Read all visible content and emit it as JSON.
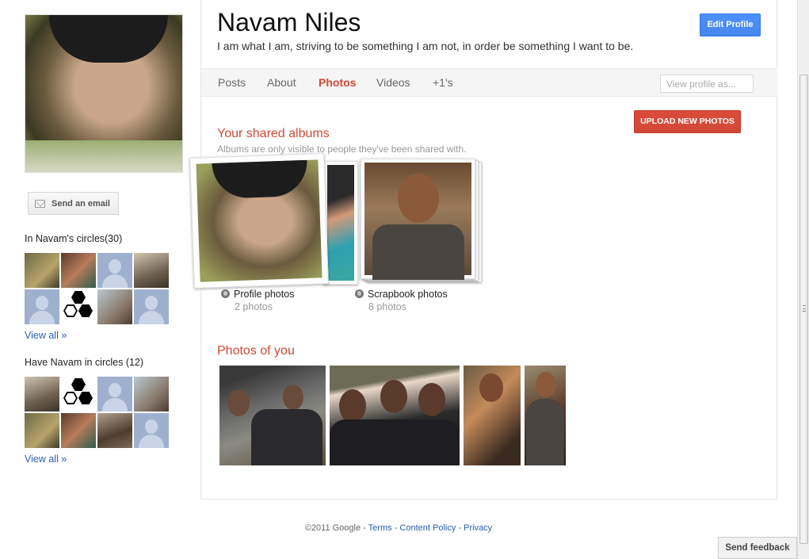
{
  "profile": {
    "name": "Navam Niles",
    "tagline": "I am what I am, striving to be something I am not, in order be something I want to be.",
    "edit_button": "Edit Profile"
  },
  "sidebar": {
    "send_email": "Send an email",
    "in_circles_title": "In Navam's circles(30)",
    "have_in_circles_title": "Have Navam in circles (12)",
    "view_all_1": "View all »",
    "view_all_2": "View all »"
  },
  "tabs": [
    {
      "label": "Posts",
      "active": false
    },
    {
      "label": "About",
      "active": false
    },
    {
      "label": "Photos",
      "active": true
    },
    {
      "label": "Videos",
      "active": false
    },
    {
      "label": "+1's",
      "active": false
    }
  ],
  "view_as_placeholder": "View profile as...",
  "upload_button": "UPLOAD NEW PHOTOS",
  "shared_albums": {
    "title": "Your shared albums",
    "subtitle": "Albums are only visible to people they've been shared with.",
    "albums": [
      {
        "name": "Profile photos",
        "count": "2 photos"
      },
      {
        "name": "Scrapbook photos",
        "count": "8 photos"
      }
    ]
  },
  "photos_of_you": {
    "title": "Photos of you"
  },
  "footer": {
    "copyright": "©2011 Google - ",
    "terms": "Terms",
    "sep1": " - ",
    "content_policy": "Content Policy",
    "sep2": " - ",
    "privacy": "Privacy"
  },
  "feedback": "Send feedback",
  "colors": {
    "accent_red": "#d14836",
    "accent_blue": "#4d90fe",
    "link_blue": "#2a5db0"
  }
}
